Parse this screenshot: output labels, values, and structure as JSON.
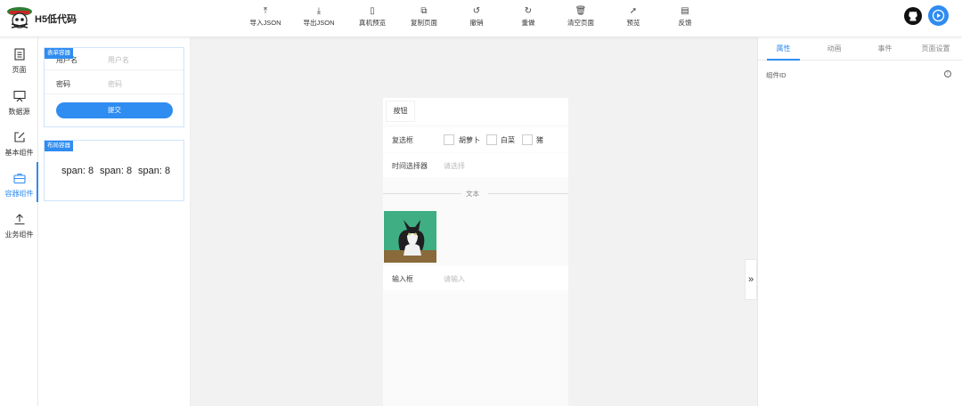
{
  "app": {
    "brand": "H5低代码"
  },
  "toolbar": [
    {
      "label": "导入JSON",
      "icon": "upload-icon",
      "glyph": "⤒"
    },
    {
      "label": "导出JSON",
      "icon": "download-icon",
      "glyph": "⤓"
    },
    {
      "label": "真机预览",
      "icon": "phone-icon",
      "glyph": "▯"
    },
    {
      "label": "复制页面",
      "icon": "copy-icon",
      "glyph": "⧉"
    },
    {
      "label": "撤销",
      "icon": "undo-icon",
      "glyph": "↺"
    },
    {
      "label": "重做",
      "icon": "redo-icon",
      "glyph": "↻"
    },
    {
      "label": "清空页面",
      "icon": "trash-icon",
      "glyph": "🗑"
    },
    {
      "label": "预览",
      "icon": "send-icon",
      "glyph": "➚"
    },
    {
      "label": "反馈",
      "icon": "message-icon",
      "glyph": "▤"
    }
  ],
  "sidebar": {
    "items": [
      {
        "label": "页面",
        "icon": "page-icon"
      },
      {
        "label": "数据源",
        "icon": "board-icon"
      },
      {
        "label": "基本组件",
        "icon": "edit-icon"
      },
      {
        "label": "容器组件",
        "icon": "briefcase-icon",
        "active": true
      },
      {
        "label": "业务组件",
        "icon": "upload-icon"
      }
    ]
  },
  "containers": {
    "form": {
      "tag": "表单容器",
      "username_label": "用户名",
      "username_placeholder": "用户名",
      "password_label": "密码",
      "password_placeholder": "密码",
      "submit": "提交"
    },
    "layout": {
      "tag": "布局容器",
      "spans": [
        "span: 8",
        "span: 8",
        "span: 8"
      ]
    }
  },
  "canvas": {
    "button_label": "按钮",
    "checkbox": {
      "label": "复选框",
      "options": [
        "胡萝卜",
        "白菜",
        "猪"
      ]
    },
    "time_picker": {
      "label": "时间选择器",
      "placeholder": "请选择"
    },
    "divider_text": "文本",
    "input": {
      "label": "输入框",
      "placeholder": "请输入"
    },
    "collapse_glyph": "»"
  },
  "right_panel": {
    "tabs": [
      "属性",
      "动画",
      "事件",
      "页面设置"
    ],
    "active_tab": 0,
    "component_id_label": "组件ID",
    "info_glyph": "!"
  },
  "colors": {
    "accent": "#2f8cf0"
  }
}
